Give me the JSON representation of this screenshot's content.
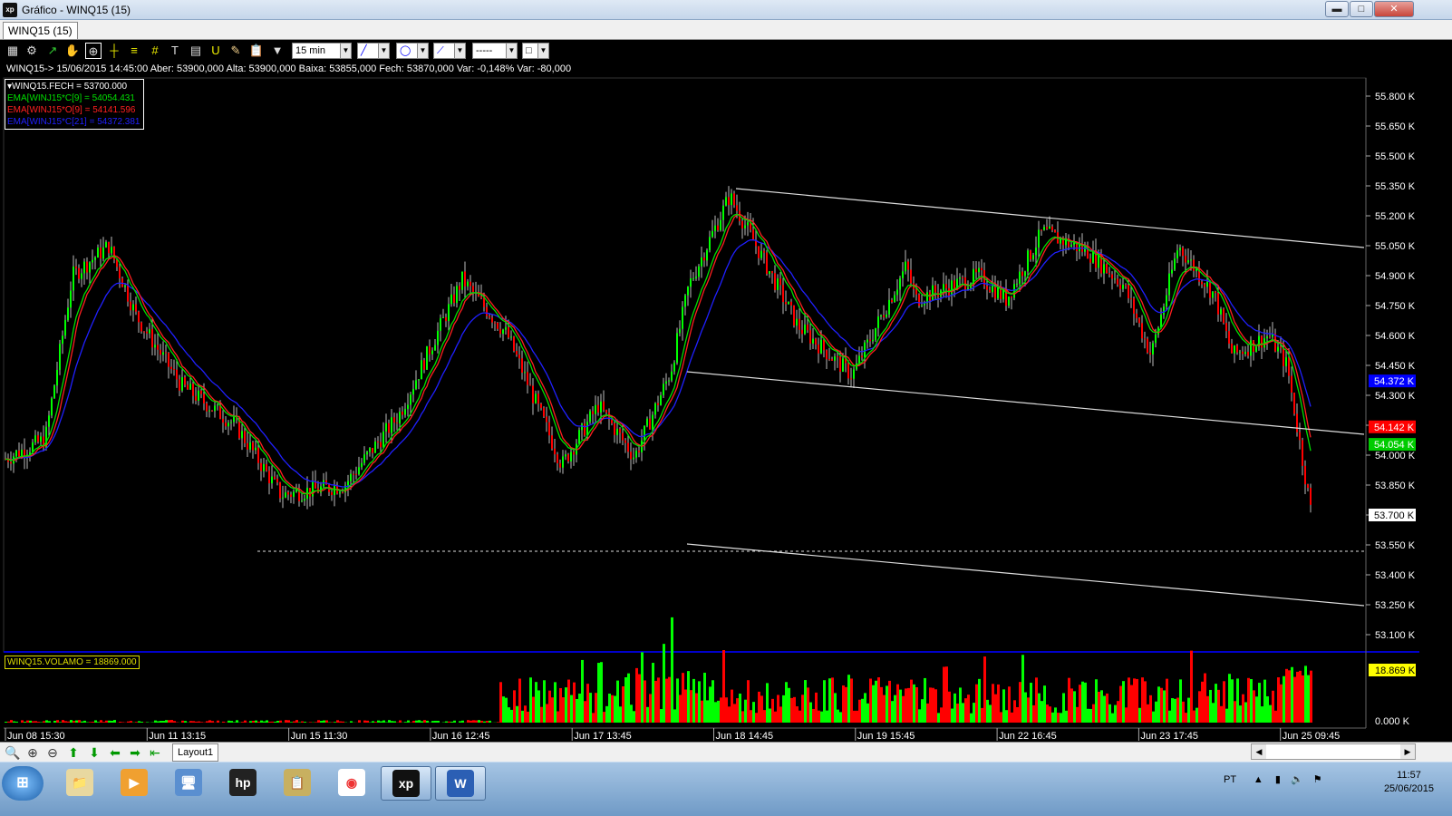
{
  "window": {
    "title": "Gráfico - WINQ15 (15)",
    "app_badge": "xp",
    "minimize": "▬",
    "maximize": "□",
    "close": "✕"
  },
  "tab": {
    "label": "WINQ15 (15)"
  },
  "toolbar": {
    "interval": "15 min",
    "line_style": "-----"
  },
  "info_line": "WINQ15-> 15/06/2015 14:45:00 Aber: 53900,000 Alta: 53900,000 Baixa: 53855,000 Fech: 53870,000 Var: -0,148% Var: -80,000",
  "legend": [
    {
      "text": "▾WINQ15.FECH = 53700.000",
      "color": "#ffffff"
    },
    {
      "text": "EMA[WINJ15*C[9] = 54054.431",
      "color": "#00e000"
    },
    {
      "text": "EMA[WINJ15*O[9] = 54141.596",
      "color": "#ff2020"
    },
    {
      "text": "EMA[WINJ15*C[21] = 54372.381",
      "color": "#2020ff"
    }
  ],
  "volume_label": "WINQ15.VOLAMO = 18869.000",
  "price_axis": {
    "ticks": [
      "55.800 K",
      "55.650 K",
      "55.500 K",
      "55.350 K",
      "55.200 K",
      "55.050 K",
      "54.900 K",
      "54.750 K",
      "54.600 K",
      "54.450 K",
      "54.300 K",
      "54.150 K",
      "54.000 K",
      "53.850 K",
      "53.700 K",
      "53.550 K",
      "53.400 K",
      "53.250 K",
      "53.100 K"
    ],
    "markers": [
      {
        "text": "54.372 K",
        "bg": "#0000ff",
        "fg": "#ffffff"
      },
      {
        "text": "54.142 K",
        "bg": "#ff0000",
        "fg": "#ffffff"
      },
      {
        "text": "54.054 K",
        "bg": "#00cc00",
        "fg": "#ffffff"
      },
      {
        "text": "53.700 K",
        "bg": "#ffffff",
        "fg": "#000000"
      }
    ]
  },
  "volume_axis": {
    "ticks": [
      "18.869 K",
      "0.000 K"
    ]
  },
  "time_axis": [
    "Jun 08 15:30",
    "Jun 11 13:15",
    "Jun 15 11:30",
    "Jun 16 12:45",
    "Jun 17 13:45",
    "Jun 18 14:45",
    "Jun 19 15:45",
    "Jun 22 16:45",
    "Jun 23 17:45",
    "Jun 25 09:45"
  ],
  "bottombar": {
    "layout_tab": "Layout1",
    "scroll_left": "◀",
    "scroll_right": "▶"
  },
  "taskbar": {
    "start": "⊞",
    "apps": [
      "explorer",
      "media-player",
      "remote-desktop",
      "hp",
      "accessories",
      "chrome",
      "xp",
      "word"
    ],
    "app_labels": [
      "📁",
      "▶",
      "🖥",
      "hp",
      "📋",
      "◉",
      "xp",
      "W"
    ],
    "lang": "PT",
    "time": "11:57",
    "date": "25/06/2015"
  },
  "colors": {
    "up": "#00ff00",
    "down": "#ff0000",
    "ema9c": "#00e000",
    "ema9o": "#ff2020",
    "ema21": "#2020ff",
    "axis_text": "#ffffff"
  }
}
